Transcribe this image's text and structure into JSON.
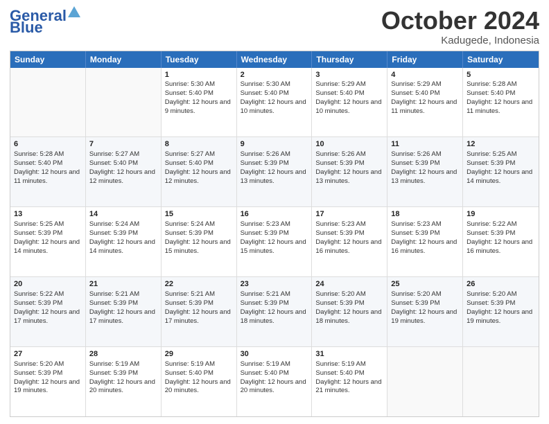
{
  "header": {
    "logo_general": "General",
    "logo_blue": "Blue",
    "month_year": "October 2024",
    "location": "Kadugede, Indonesia"
  },
  "days_of_week": [
    "Sunday",
    "Monday",
    "Tuesday",
    "Wednesday",
    "Thursday",
    "Friday",
    "Saturday"
  ],
  "weeks": [
    [
      {
        "day": "",
        "empty": true
      },
      {
        "day": "",
        "empty": true
      },
      {
        "day": "1",
        "sunrise": "5:30 AM",
        "sunset": "5:40 PM",
        "daylight": "12 hours and 9 minutes."
      },
      {
        "day": "2",
        "sunrise": "5:30 AM",
        "sunset": "5:40 PM",
        "daylight": "12 hours and 10 minutes."
      },
      {
        "day": "3",
        "sunrise": "5:29 AM",
        "sunset": "5:40 PM",
        "daylight": "12 hours and 10 minutes."
      },
      {
        "day": "4",
        "sunrise": "5:29 AM",
        "sunset": "5:40 PM",
        "daylight": "12 hours and 11 minutes."
      },
      {
        "day": "5",
        "sunrise": "5:28 AM",
        "sunset": "5:40 PM",
        "daylight": "12 hours and 11 minutes."
      }
    ],
    [
      {
        "day": "6",
        "sunrise": "5:28 AM",
        "sunset": "5:40 PM",
        "daylight": "12 hours and 11 minutes."
      },
      {
        "day": "7",
        "sunrise": "5:27 AM",
        "sunset": "5:40 PM",
        "daylight": "12 hours and 12 minutes."
      },
      {
        "day": "8",
        "sunrise": "5:27 AM",
        "sunset": "5:40 PM",
        "daylight": "12 hours and 12 minutes."
      },
      {
        "day": "9",
        "sunrise": "5:26 AM",
        "sunset": "5:39 PM",
        "daylight": "12 hours and 13 minutes."
      },
      {
        "day": "10",
        "sunrise": "5:26 AM",
        "sunset": "5:39 PM",
        "daylight": "12 hours and 13 minutes."
      },
      {
        "day": "11",
        "sunrise": "5:26 AM",
        "sunset": "5:39 PM",
        "daylight": "12 hours and 13 minutes."
      },
      {
        "day": "12",
        "sunrise": "5:25 AM",
        "sunset": "5:39 PM",
        "daylight": "12 hours and 14 minutes."
      }
    ],
    [
      {
        "day": "13",
        "sunrise": "5:25 AM",
        "sunset": "5:39 PM",
        "daylight": "12 hours and 14 minutes."
      },
      {
        "day": "14",
        "sunrise": "5:24 AM",
        "sunset": "5:39 PM",
        "daylight": "12 hours and 14 minutes."
      },
      {
        "day": "15",
        "sunrise": "5:24 AM",
        "sunset": "5:39 PM",
        "daylight": "12 hours and 15 minutes."
      },
      {
        "day": "16",
        "sunrise": "5:23 AM",
        "sunset": "5:39 PM",
        "daylight": "12 hours and 15 minutes."
      },
      {
        "day": "17",
        "sunrise": "5:23 AM",
        "sunset": "5:39 PM",
        "daylight": "12 hours and 16 minutes."
      },
      {
        "day": "18",
        "sunrise": "5:23 AM",
        "sunset": "5:39 PM",
        "daylight": "12 hours and 16 minutes."
      },
      {
        "day": "19",
        "sunrise": "5:22 AM",
        "sunset": "5:39 PM",
        "daylight": "12 hours and 16 minutes."
      }
    ],
    [
      {
        "day": "20",
        "sunrise": "5:22 AM",
        "sunset": "5:39 PM",
        "daylight": "12 hours and 17 minutes."
      },
      {
        "day": "21",
        "sunrise": "5:21 AM",
        "sunset": "5:39 PM",
        "daylight": "12 hours and 17 minutes."
      },
      {
        "day": "22",
        "sunrise": "5:21 AM",
        "sunset": "5:39 PM",
        "daylight": "12 hours and 17 minutes."
      },
      {
        "day": "23",
        "sunrise": "5:21 AM",
        "sunset": "5:39 PM",
        "daylight": "12 hours and 18 minutes."
      },
      {
        "day": "24",
        "sunrise": "5:20 AM",
        "sunset": "5:39 PM",
        "daylight": "12 hours and 18 minutes."
      },
      {
        "day": "25",
        "sunrise": "5:20 AM",
        "sunset": "5:39 PM",
        "daylight": "12 hours and 19 minutes."
      },
      {
        "day": "26",
        "sunrise": "5:20 AM",
        "sunset": "5:39 PM",
        "daylight": "12 hours and 19 minutes."
      }
    ],
    [
      {
        "day": "27",
        "sunrise": "5:20 AM",
        "sunset": "5:39 PM",
        "daylight": "12 hours and 19 minutes."
      },
      {
        "day": "28",
        "sunrise": "5:19 AM",
        "sunset": "5:39 PM",
        "daylight": "12 hours and 20 minutes."
      },
      {
        "day": "29",
        "sunrise": "5:19 AM",
        "sunset": "5:40 PM",
        "daylight": "12 hours and 20 minutes."
      },
      {
        "day": "30",
        "sunrise": "5:19 AM",
        "sunset": "5:40 PM",
        "daylight": "12 hours and 20 minutes."
      },
      {
        "day": "31",
        "sunrise": "5:19 AM",
        "sunset": "5:40 PM",
        "daylight": "12 hours and 21 minutes."
      },
      {
        "day": "",
        "empty": true
      },
      {
        "day": "",
        "empty": true
      }
    ]
  ],
  "labels": {
    "sunrise_prefix": "Sunrise: ",
    "sunset_prefix": "Sunset: ",
    "daylight_prefix": "Daylight: "
  }
}
